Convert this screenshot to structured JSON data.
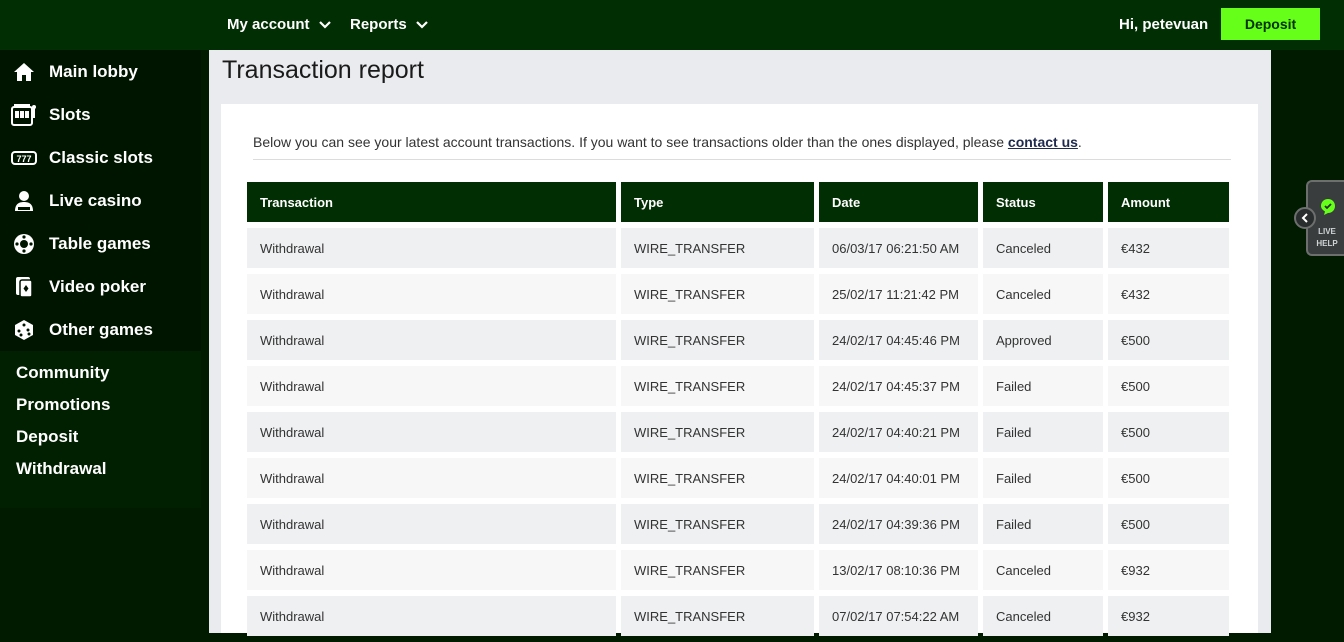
{
  "header": {
    "nav": [
      {
        "label": "My account",
        "icon": "chevron-down-icon"
      },
      {
        "label": "Reports",
        "icon": "chevron-down-icon"
      }
    ],
    "greeting": "Hi, petevuan",
    "deposit_label": "Deposit",
    "accent": "#66ff1a"
  },
  "sidebar": {
    "main_items": [
      {
        "label": "Main lobby",
        "icon": "home-icon"
      },
      {
        "label": "Slots",
        "icon": "slot-machine-icon"
      },
      {
        "label": "Classic slots",
        "icon": "classic-slots-icon"
      },
      {
        "label": "Live casino",
        "icon": "dealer-icon"
      },
      {
        "label": "Table games",
        "icon": "roulette-icon"
      },
      {
        "label": "Video poker",
        "icon": "cards-icon"
      },
      {
        "label": "Other games",
        "icon": "dice-icon"
      }
    ],
    "sub_items": [
      {
        "label": "Community"
      },
      {
        "label": "Promotions"
      },
      {
        "label": "Deposit"
      },
      {
        "label": "Withdrawal"
      }
    ]
  },
  "page": {
    "title": "Transaction report",
    "intro_text": "Below you can see your latest account transactions. If you want to see transactions older than the ones displayed, please ",
    "intro_link": "contact us",
    "intro_end": "."
  },
  "table": {
    "headers": [
      "Transaction",
      "Type",
      "Date",
      "Status",
      "Amount"
    ],
    "rows": [
      [
        "Withdrawal",
        "WIRE_TRANSFER",
        "06/03/17 06:21:50 AM",
        "Canceled",
        "€432"
      ],
      [
        "Withdrawal",
        "WIRE_TRANSFER",
        "25/02/17 11:21:42 PM",
        "Canceled",
        "€432"
      ],
      [
        "Withdrawal",
        "WIRE_TRANSFER",
        "24/02/17 04:45:46 PM",
        "Approved",
        "€500"
      ],
      [
        "Withdrawal",
        "WIRE_TRANSFER",
        "24/02/17 04:45:37 PM",
        "Failed",
        "€500"
      ],
      [
        "Withdrawal",
        "WIRE_TRANSFER",
        "24/02/17 04:40:21 PM",
        "Failed",
        "€500"
      ],
      [
        "Withdrawal",
        "WIRE_TRANSFER",
        "24/02/17 04:40:01 PM",
        "Failed",
        "€500"
      ],
      [
        "Withdrawal",
        "WIRE_TRANSFER",
        "24/02/17 04:39:36 PM",
        "Failed",
        "€500"
      ],
      [
        "Withdrawal",
        "WIRE_TRANSFER",
        "13/02/17 08:10:36 PM",
        "Canceled",
        "€932"
      ],
      [
        "Withdrawal",
        "WIRE_TRANSFER",
        "07/02/17 07:54:22 AM",
        "Canceled",
        "€932"
      ]
    ]
  },
  "live_help": {
    "line1": "LIVE",
    "line2": "HELP",
    "icon": "chat-bubble-icon",
    "collapse_icon": "chevron-left-icon"
  }
}
